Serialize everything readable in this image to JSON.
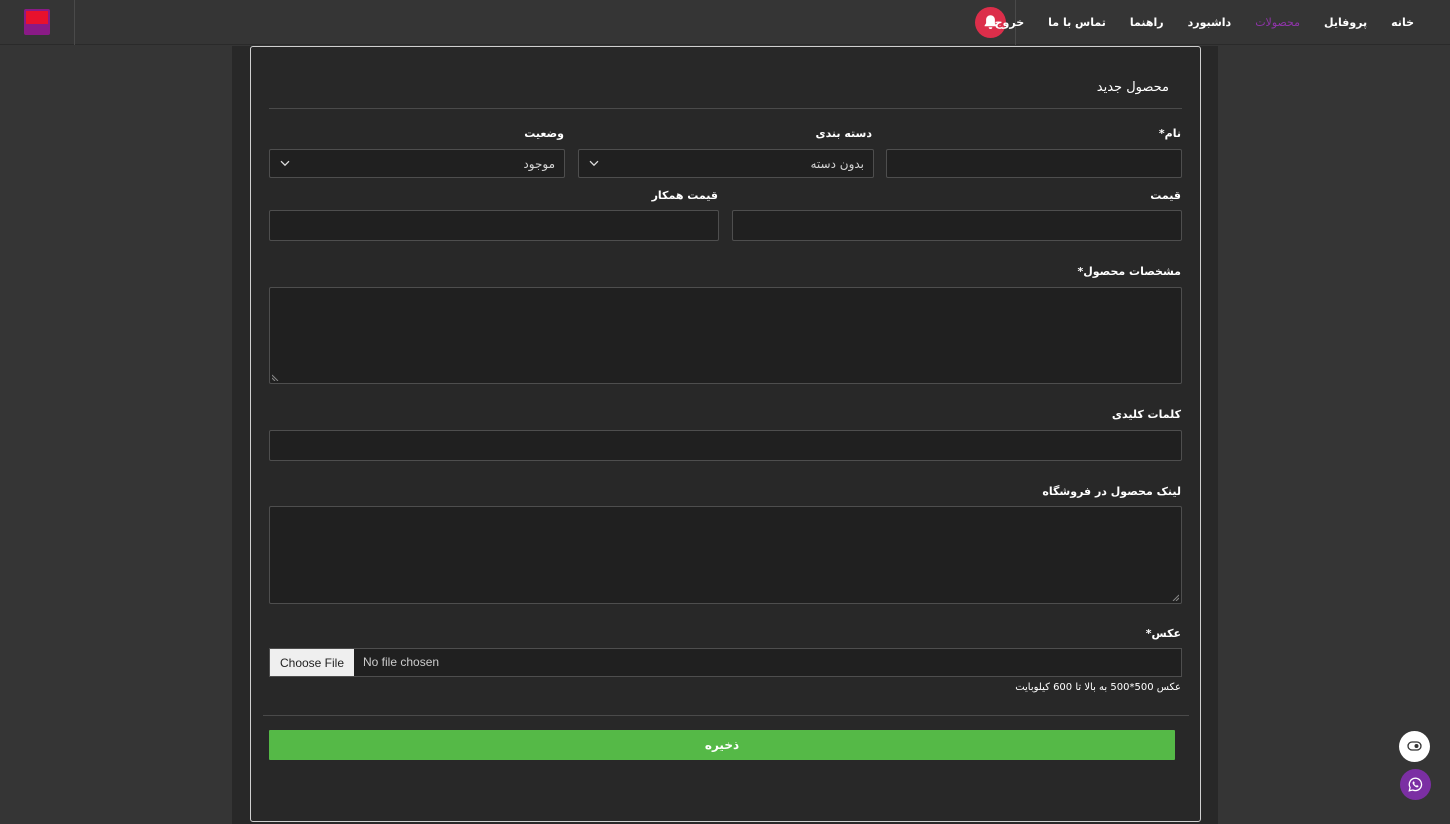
{
  "nav": {
    "items": [
      "خانه",
      "پروفایل",
      "محصولات",
      "داشبورد",
      "راهنما",
      "تماس با ما",
      "خروج"
    ],
    "active_index": 2
  },
  "form": {
    "title": "محصول جدید",
    "name_label": "نام*",
    "category_label": "دسته بندی",
    "category_value": "بدون دسته",
    "status_label": "وضعیت",
    "status_value": "موجود",
    "price_label": "قیمت",
    "partner_price_label": "قیمت همکار",
    "specs_label": "مشخصات محصول*",
    "keywords_label": "کلمات کلیدی",
    "store_link_label": "لینک محصول در فروشگاه",
    "image_label": "عکس*",
    "file_button": "Choose File",
    "file_status": "No file chosen",
    "image_hint": "عکس 500*500 به بالا تا 600 کیلوبایت",
    "save_label": "ذخیره"
  },
  "colors": {
    "accent": "#8e34a8",
    "bell": "#dc2e4a",
    "save": "#55b947",
    "background": "#353535"
  },
  "icons": {
    "logo": "app-logo",
    "bell": "bell-icon",
    "eye": "eye-icon",
    "chat": "whatsapp-icon"
  }
}
